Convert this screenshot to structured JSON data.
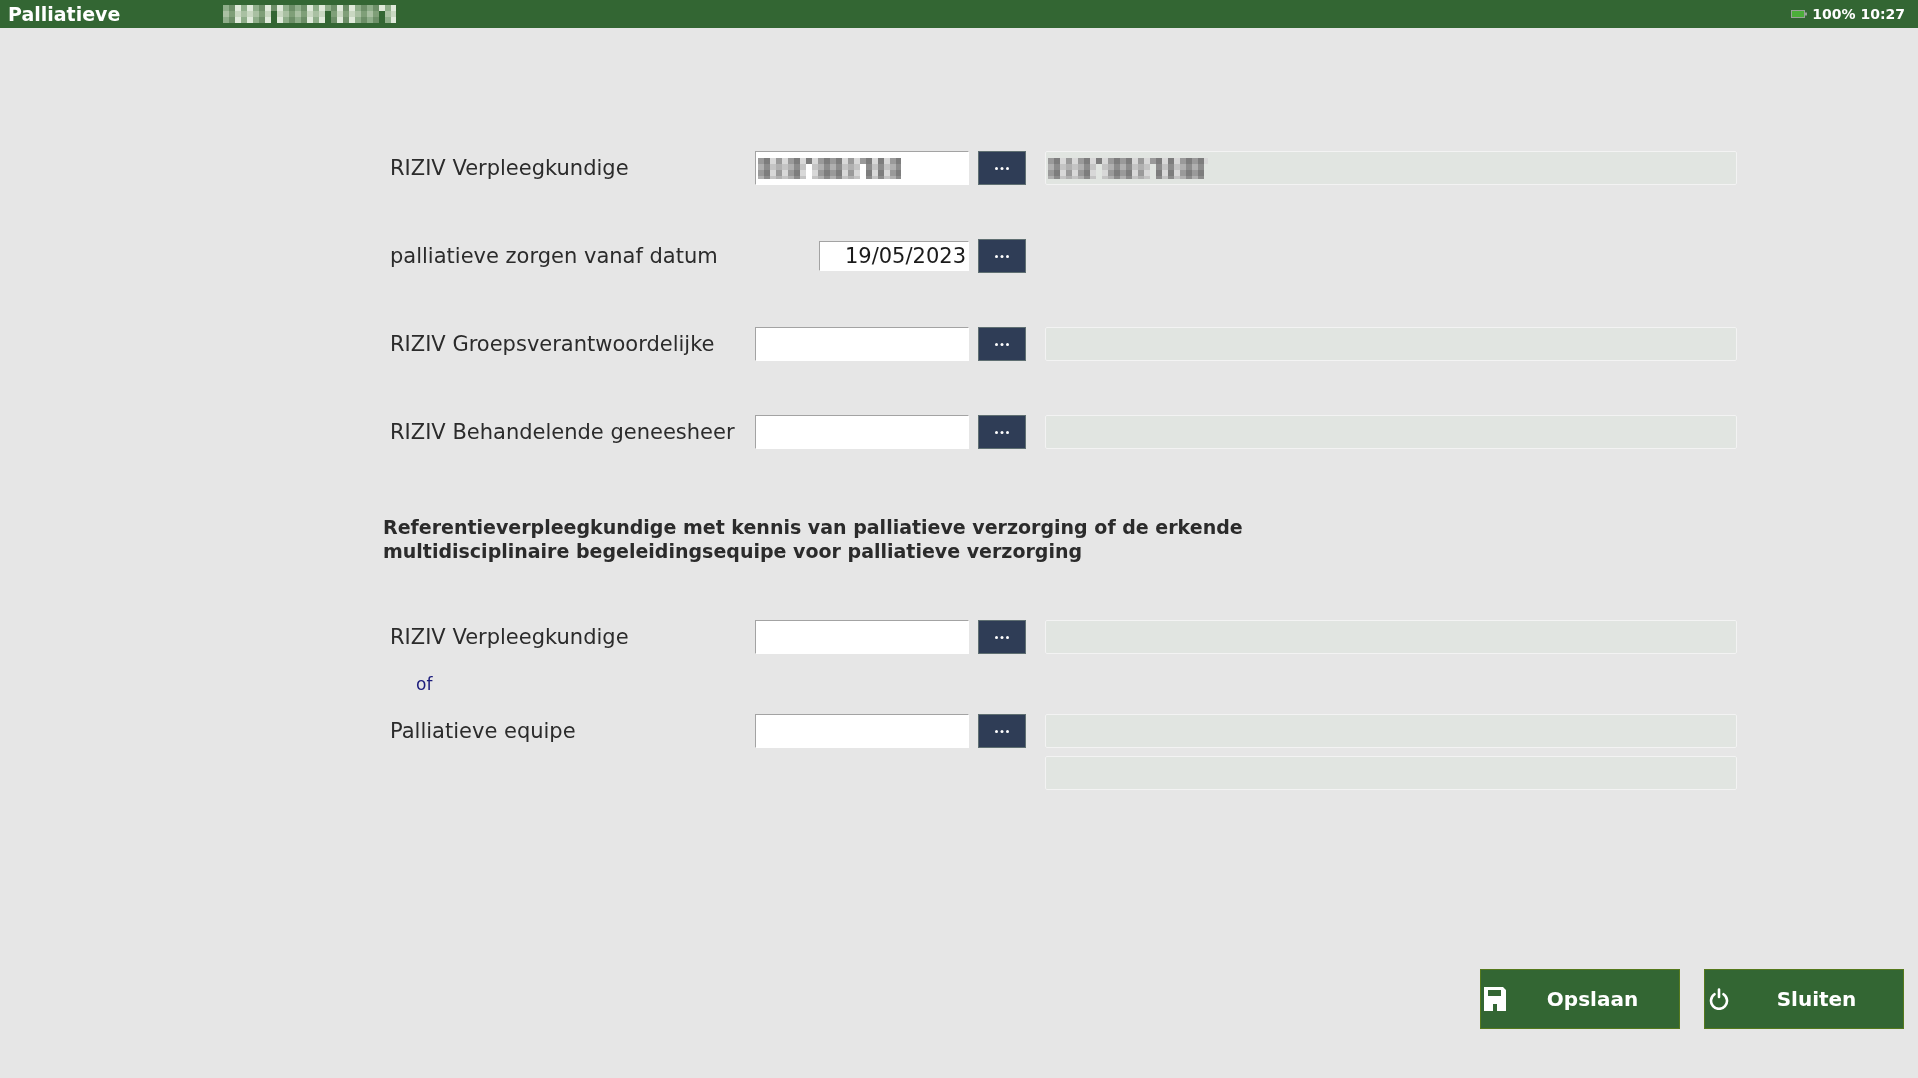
{
  "title_bar": {
    "title": "Palliatieve",
    "subtitle_redacted": true,
    "battery_percent": "100%",
    "time": "10:27"
  },
  "sections": [
    {
      "rows": [
        {
          "kind": "lookup",
          "label": "RIZIV Verpleegkundige",
          "code_redacted": true,
          "name_fields": [
            {
              "redacted": true
            }
          ]
        },
        {
          "kind": "date",
          "label": "palliatieve zorgen vanaf datum",
          "value": "19/05/2023"
        },
        {
          "kind": "lookup",
          "label": "RIZIV Groepsverantwoordelijke",
          "code_redacted": false,
          "name_fields": [
            {
              "redacted": false
            }
          ]
        },
        {
          "kind": "lookup",
          "label": "RIZIV Behandelende geneesheer",
          "code_redacted": false,
          "name_fields": [
            {
              "redacted": false
            }
          ]
        }
      ]
    },
    {
      "heading": "Referentieverpleegkundige met kennis van palliatieve verzorging of de erkende multidisciplinaire begeleidingsequipe voor palliatieve verzorging",
      "rows": [
        {
          "kind": "lookup",
          "label": "RIZIV Verpleegkundige",
          "code_redacted": false,
          "name_fields": [
            {
              "redacted": false
            }
          ]
        },
        {
          "kind": "separator",
          "text": "of"
        },
        {
          "kind": "lookup",
          "label": "Palliatieve equipe",
          "code_redacted": false,
          "name_fields": [
            {
              "redacted": false
            },
            {
              "redacted": false
            }
          ]
        }
      ]
    }
  ],
  "buttons": [
    {
      "kind": "save",
      "label": "Opslaan"
    },
    {
      "kind": "close",
      "label": "Sluiten"
    }
  ]
}
